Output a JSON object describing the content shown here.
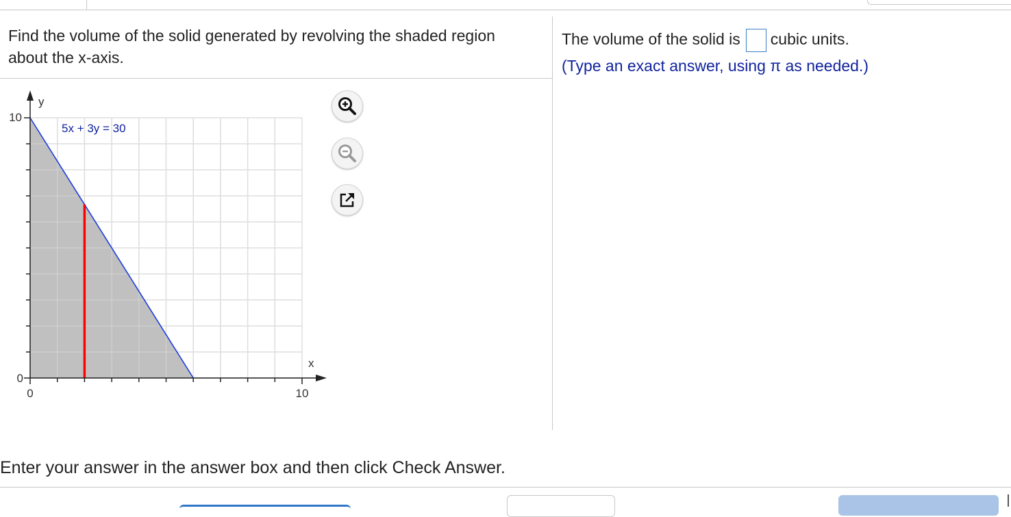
{
  "question": {
    "text": "Find the volume of the solid generated by revolving the shaded region about the x-axis."
  },
  "answer": {
    "prefix": "The volume of the solid is",
    "suffix": "cubic units.",
    "value": "",
    "hint": "(Type an exact answer, using π as needed.)"
  },
  "graph": {
    "y_axis_label": "y",
    "x_axis_label": "x",
    "y_tick_top": "10",
    "y_tick_bottom": "0",
    "x_tick_left": "0",
    "x_tick_right": "10",
    "equation_label": "5x + 3y = 30",
    "shade_color": "#c0c0c0",
    "line_color": "#1a3be0",
    "strip_color": "#ff0000"
  },
  "chart_data": {
    "type": "area",
    "x_range": [
      0,
      10
    ],
    "y_range": [
      0,
      10
    ],
    "grid": true,
    "line": {
      "equation": "5x + 3y = 30",
      "points": [
        [
          0,
          10
        ],
        [
          6,
          0
        ]
      ]
    },
    "shaded_region": [
      [
        0,
        0
      ],
      [
        0,
        10
      ],
      [
        6,
        0
      ]
    ],
    "strip": {
      "x": 2,
      "y_from": 0,
      "y_to": 6.67
    }
  },
  "tools": {
    "zoom_in": "zoom-in-icon",
    "zoom_out": "zoom-out-icon",
    "popout": "popout-icon"
  },
  "instruction": "Enter your answer in the answer box and then click Check Answer."
}
